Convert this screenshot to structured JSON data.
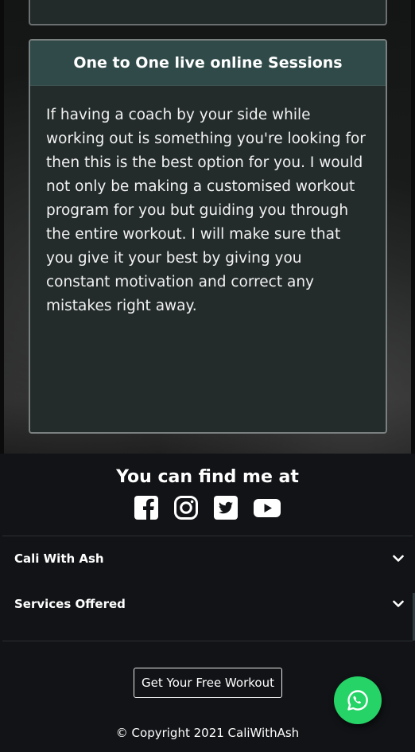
{
  "service_card": {
    "title": "One to One live online Sessions",
    "description": "If having a coach by your side while working out is something you're looking for then this is the best option for you. I would not only be making a customised workout program for you but guiding you through the entire workout. I will make sure that you give it your best by giving you constant motivation and correct any mistakes right away."
  },
  "footer": {
    "find_title": "You can find me at",
    "social_icons": [
      "facebook-icon",
      "instagram-icon",
      "twitter-icon",
      "youtube-icon"
    ],
    "accordion": [
      {
        "label": "Cali With Ash",
        "icon": "chevron-down-icon"
      },
      {
        "label": "Services Offered",
        "icon": "chevron-down-icon"
      }
    ],
    "cta_label": "Get Your Free Workout",
    "copyright": "© Copyright 2021 CaliWithAsh"
  },
  "floating": {
    "icon": "whatsapp-icon",
    "color": "#25d366"
  },
  "colors": {
    "background": "#111316",
    "card_header": "#2f4a48",
    "card_body": "#232b2b",
    "text": "#ffffff"
  }
}
